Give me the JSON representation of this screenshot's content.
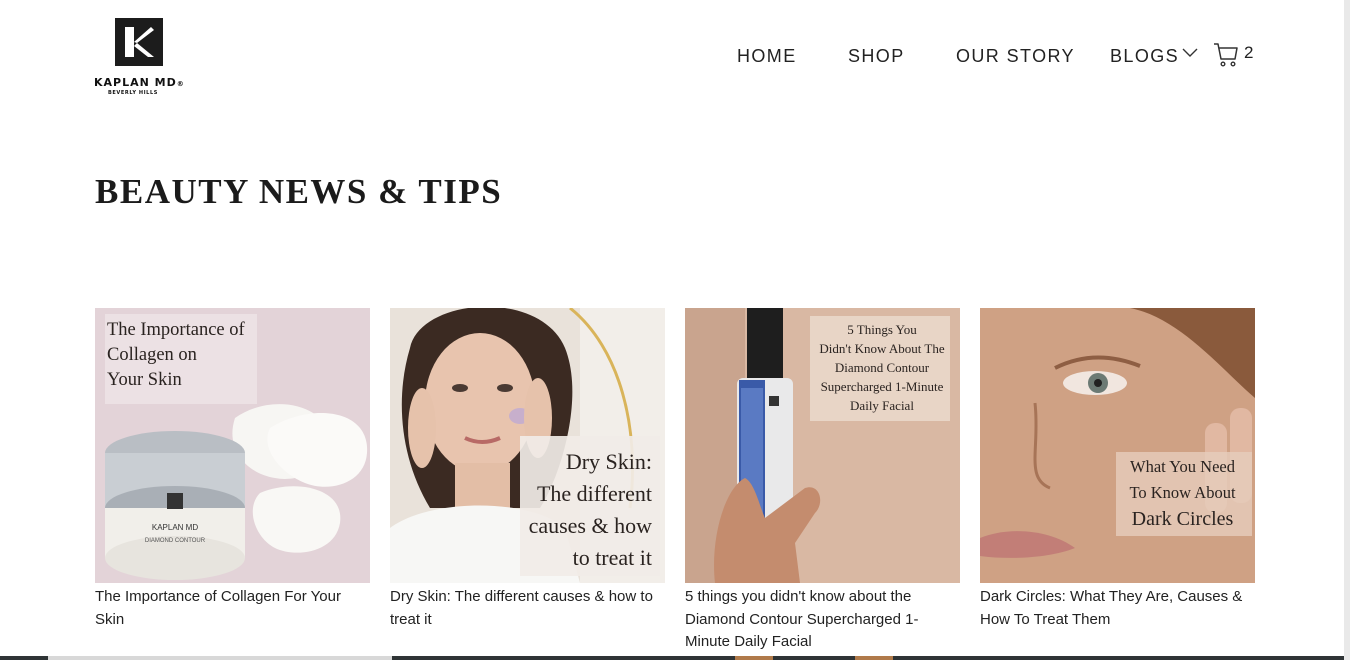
{
  "brand": {
    "name": "KAPLAN MD",
    "registered": "®",
    "location": "BEVERLY HILLS",
    "mark_letter": "K"
  },
  "nav": {
    "items": [
      {
        "label": "HOME"
      },
      {
        "label": "SHOP"
      },
      {
        "label": "OUR STORY"
      },
      {
        "label": "BLOGS"
      }
    ],
    "blogs_icon": "chevron-down-icon",
    "cart_icon": "shopping-cart-icon",
    "cart_count": "2"
  },
  "page": {
    "title": "BEAUTY NEWS & TIPS"
  },
  "posts": [
    {
      "title": "The Importance of Collagen For Your Skin",
      "image_text": [
        "The Importance of",
        "Collagen on",
        "Your Skin"
      ],
      "product_text": "KAPLAN MD",
      "product_line": "DIAMOND CONTOUR"
    },
    {
      "title": "Dry Skin: The different causes & how to treat it",
      "image_text": [
        "Dry Skin:",
        "The different",
        "causes & how",
        "to treat it"
      ]
    },
    {
      "title": "5 things you didn't know about the Diamond Contour Supercharged 1-Minute Daily Facial",
      "image_text": [
        "5 Things You",
        "Didn't Know About The",
        "Diamond Contour",
        "Supercharged 1-Minute",
        "Daily Facial"
      ]
    },
    {
      "title": "Dark Circles: What They Are, Causes & How To Treat Them",
      "image_text": [
        "What You Need",
        "To Know About",
        "Dark Circles"
      ]
    }
  ],
  "colors": {
    "text": "#222222",
    "card1_bg": "#e3d3d8",
    "card2_bg": "#e9e2da",
    "card3_bg": "#d9b8a3",
    "card4_bg": "#c69a7f"
  }
}
